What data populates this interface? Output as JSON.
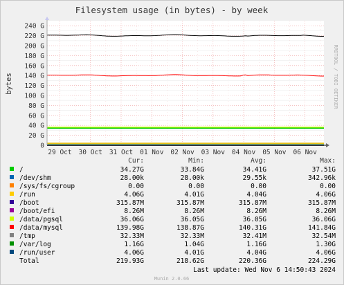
{
  "chart_data": {
    "type": "line",
    "title": "Filesystem usage (in bytes) - by week",
    "ylabel": "bytes",
    "side_label": "RRDTOOL / TOBI OETIKER",
    "ylim": [
      0,
      250
    ],
    "y_ticks": [
      {
        "value": 0,
        "label": "0"
      },
      {
        "value": 20,
        "label": "20 G"
      },
      {
        "value": 40,
        "label": "40 G"
      },
      {
        "value": 60,
        "label": "60 G"
      },
      {
        "value": 80,
        "label": "80 G"
      },
      {
        "value": 100,
        "label": "100 G"
      },
      {
        "value": 120,
        "label": "120 G"
      },
      {
        "value": 140,
        "label": "140 G"
      },
      {
        "value": 160,
        "label": "160 G"
      },
      {
        "value": 180,
        "label": "180 G"
      },
      {
        "value": 200,
        "label": "200 G"
      },
      {
        "value": 220,
        "label": "220 G"
      },
      {
        "value": 240,
        "label": "240 G"
      }
    ],
    "x_dates": [
      "2024-10-29",
      "2024-10-30",
      "2024-10-31",
      "2024-11-01",
      "2024-11-02",
      "2024-11-03",
      "2024-11-04",
      "2024-11-05",
      "2024-11-06"
    ],
    "x_tick_labels": [
      "29 Oct",
      "30 Oct",
      "31 Oct",
      "01 Nov",
      "02 Nov",
      "03 Nov",
      "04 Nov",
      "05 Nov",
      "06 Nov"
    ],
    "x_range": [
      "2024-10-28T14:00",
      "2024-11-06T14:50"
    ],
    "unit": "G",
    "columns": [
      "Cur:",
      "Min:",
      "Avg:",
      "Max:"
    ],
    "series": [
      {
        "name": "/",
        "color": "#00cc00",
        "cur": "34.27G",
        "min": "33.84G",
        "avg": "34.41G",
        "max": "37.51G",
        "plot": "flat",
        "level": 34.4
      },
      {
        "name": "/dev/shm",
        "color": "#0066b3",
        "cur": "28.00k",
        "min": "28.00k",
        "avg": "29.55k",
        "max": "342.96k",
        "plot": "flat",
        "level": 0.0
      },
      {
        "name": "/sys/fs/cgroup",
        "color": "#ff8000",
        "cur": "0.00",
        "min": "0.00",
        "avg": "0.00",
        "max": "0.00",
        "plot": "flat",
        "level": 0.0
      },
      {
        "name": "/run",
        "color": "#ffcc00",
        "cur": "4.06G",
        "min": "4.01G",
        "avg": "4.04G",
        "max": "4.06G",
        "plot": "flat",
        "level": 4.04
      },
      {
        "name": "/boot",
        "color": "#330099",
        "cur": "315.87M",
        "min": "315.87M",
        "avg": "315.87M",
        "max": "315.87M",
        "plot": "flat",
        "level": 0.32
      },
      {
        "name": "/boot/efi",
        "color": "#990099",
        "cur": "8.26M",
        "min": "8.26M",
        "avg": "8.26M",
        "max": "8.26M",
        "plot": "flat",
        "level": 0.01
      },
      {
        "name": "/data/pgsql",
        "color": "#ccff00",
        "cur": "36.06G",
        "min": "36.05G",
        "avg": "36.05G",
        "max": "36.06G",
        "plot": "flat",
        "level": 36.05
      },
      {
        "name": "/data/mysql",
        "color": "#ff0000",
        "cur": "139.98G",
        "min": "138.87G",
        "avg": "140.31G",
        "max": "141.84G",
        "plot": "mysql",
        "level": 140.3
      },
      {
        "name": "/tmp",
        "color": "#808080",
        "cur": "32.33M",
        "min": "32.33M",
        "avg": "32.41M",
        "max": "32.54M",
        "plot": "flat",
        "level": 0.03
      },
      {
        "name": "/var/log",
        "color": "#008f00",
        "cur": "1.16G",
        "min": "1.04G",
        "avg": "1.16G",
        "max": "1.30G",
        "plot": "flat",
        "level": 1.16
      },
      {
        "name": "/run/user",
        "color": "#00487d",
        "cur": "4.06G",
        "min": "4.01G",
        "avg": "4.04G",
        "max": "4.06G",
        "plot": "flat",
        "level": 4.04
      },
      {
        "name": "Total",
        "color": "#000000",
        "cur": "219.93G",
        "min": "218.62G",
        "avg": "220.36G",
        "max": "224.29G",
        "plot": "total",
        "level": 220.4
      }
    ],
    "last_update": "Last update: Wed Nov  6 14:50:43 2024",
    "footer": "Munin 2.0.66",
    "grid": true
  }
}
